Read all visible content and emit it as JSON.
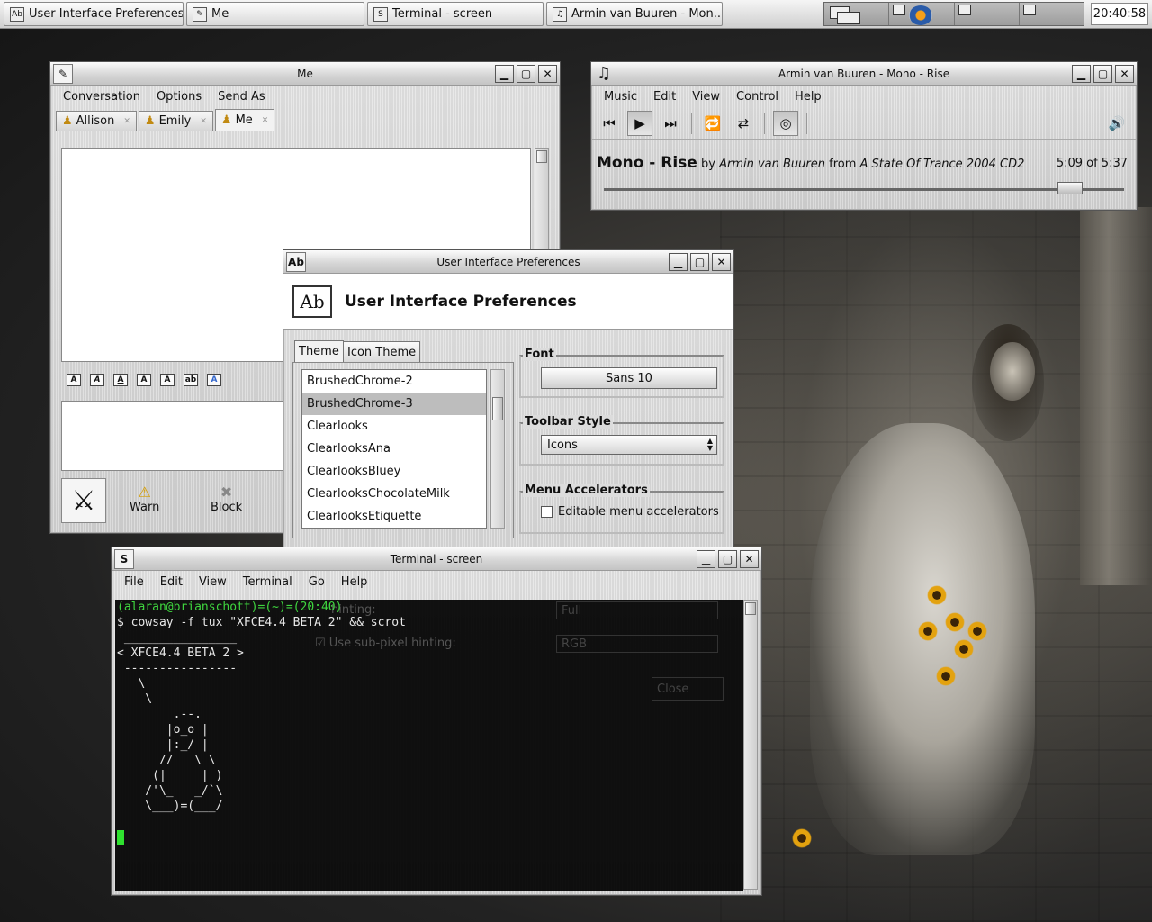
{
  "taskbar": {
    "tasks": [
      {
        "label": "User Interface Preferences",
        "icon": "ab-icon"
      },
      {
        "label": "Me",
        "icon": "pen-icon"
      },
      {
        "label": "Terminal - screen",
        "icon": "terminal-icon"
      },
      {
        "label": "Armin van Buuren - Mon...",
        "icon": "music-note-icon"
      }
    ],
    "clock": "20:40:58"
  },
  "me_window": {
    "title": "Me",
    "menu": [
      "Conversation",
      "Options",
      "Send As"
    ],
    "tabs": [
      "Allison",
      "Emily",
      "Me"
    ],
    "actions": [
      {
        "label": "Warn",
        "icon": "warning-icon"
      },
      {
        "label": "Block",
        "icon": "block-icon"
      }
    ]
  },
  "player_window": {
    "title": "Armin van Buuren - Mono - Rise",
    "menu": [
      "Music",
      "Edit",
      "View",
      "Control",
      "Help"
    ],
    "song": "Mono - Rise",
    "by_word": "by",
    "artist": "Armin van Buuren",
    "from_word": "from",
    "album": "A State Of Trance 2004 CD2",
    "time": "5:09 of 5:37",
    "progress": 0.917
  },
  "prefs_window": {
    "title": "User Interface Preferences",
    "header": "User Interface Preferences",
    "tabs": [
      "Theme",
      "Icon Theme"
    ],
    "themes": [
      "BrushedChrome-2",
      "BrushedChrome-3",
      "Clearlooks",
      "ClearlooksAna",
      "ClearlooksBluey",
      "ClearlooksChocolateMilk",
      "ClearlooksEtiquette"
    ],
    "selected_theme": "BrushedChrome-3",
    "font_label": "Font",
    "font_value": "Sans 10",
    "toolbar_label": "Toolbar Style",
    "toolbar_value": "Icons",
    "accel_label": "Menu Accelerators",
    "accel_check": "Editable menu accelerators",
    "hidden_rows": {
      "hinting_label": "hinting:",
      "hinting_value": "Full",
      "subpixel_label": "Use sub-pixel hinting:",
      "subpixel_value": "RGB",
      "close": "Close"
    }
  },
  "terminal_window": {
    "title": "Terminal - screen",
    "menu": [
      "File",
      "Edit",
      "View",
      "Terminal",
      "Go",
      "Help"
    ],
    "prompt": "(alaran@brianschott)=(~)=(20:40)",
    "command": "$ cowsay -f tux \"XFCE4.4 BETA 2\" && scrot",
    "output": [
      " ________________",
      "< XFCE4.4 BETA 2 >",
      " ----------------",
      "   \\",
      "    \\",
      "        .--.",
      "       |o_o |",
      "       |:_/ |",
      "      //   \\ \\",
      "     (|     | )",
      "    /'\\_   _/`\\",
      "    \\___)=(___/"
    ]
  }
}
